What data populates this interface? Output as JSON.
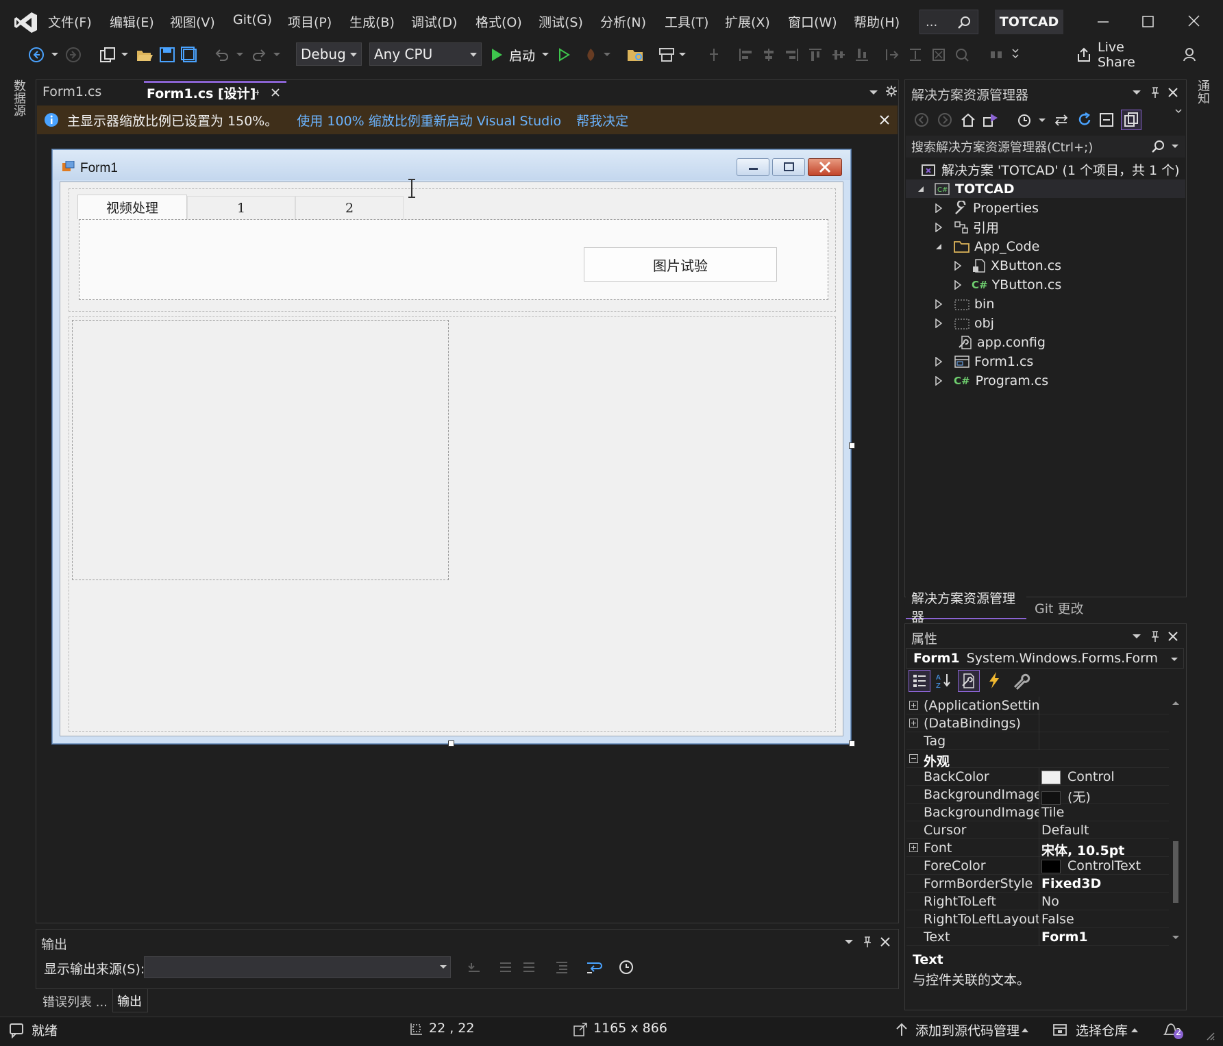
{
  "app": {
    "solution_name": "TOTCAD",
    "search_dots": "..."
  },
  "menu": [
    "文件(F)",
    "编辑(E)",
    "视图(V)",
    "Git(G)",
    "项目(P)",
    "生成(B)",
    "调试(D)",
    "格式(O)",
    "测试(S)",
    "分析(N)",
    "工具(T)",
    "扩展(X)",
    "窗口(W)",
    "帮助(H)"
  ],
  "toolbar": {
    "config": "Debug",
    "platform": "Any CPU",
    "start_label": "启动",
    "live_share": "Live Share"
  },
  "side_left": {
    "label": "数据源"
  },
  "side_right": {
    "label": "通知"
  },
  "tabs": [
    {
      "label": "Form1.cs"
    },
    {
      "label": "Form1.cs [设计]"
    }
  ],
  "infobar": {
    "message": "主显示器缩放比例已设置为 150%。",
    "link1": "使用 100% 缩放比例重新启动 Visual Studio",
    "link2": "帮我决定"
  },
  "form": {
    "title": "Form1",
    "tabs": [
      "视频处理",
      "1",
      "2"
    ],
    "button": "图片试验"
  },
  "solution_explorer": {
    "title": "解决方案资源管理器",
    "search_placeholder": "搜索解决方案资源管理器(Ctrl+;)",
    "items": [
      {
        "label": "解决方案 'TOTCAD' (1 个项目，共 1 个)"
      },
      {
        "label": "TOTCAD"
      },
      {
        "label": "Properties"
      },
      {
        "label": "引用"
      },
      {
        "label": "App_Code"
      },
      {
        "label": "XButton.cs"
      },
      {
        "label": "YButton.cs"
      },
      {
        "label": "bin"
      },
      {
        "label": "obj"
      },
      {
        "label": "app.config"
      },
      {
        "label": "Form1.cs"
      },
      {
        "label": "Program.cs"
      }
    ],
    "tabs": [
      "解决方案资源管理器",
      "Git 更改"
    ]
  },
  "properties": {
    "title": "属性",
    "object_name": "Form1",
    "object_type": "System.Windows.Forms.Form",
    "rows": [
      {
        "name": "(ApplicationSetting",
        "value": ""
      },
      {
        "name": "(DataBindings)",
        "value": ""
      },
      {
        "name": "Tag",
        "value": ""
      },
      {
        "name": "外观",
        "value": ""
      },
      {
        "name": "BackColor",
        "value": "Control"
      },
      {
        "name": "BackgroundImage",
        "value": "(无)"
      },
      {
        "name": "BackgroundImageL",
        "value": "Tile"
      },
      {
        "name": "Cursor",
        "value": "Default"
      },
      {
        "name": "Font",
        "value": "宋体, 10.5pt"
      },
      {
        "name": "ForeColor",
        "value": "ControlText"
      },
      {
        "name": "FormBorderStyle",
        "value": "Fixed3D"
      },
      {
        "name": "RightToLeft",
        "value": "No"
      },
      {
        "name": "RightToLeftLayout",
        "value": "False"
      },
      {
        "name": "Text",
        "value": "Form1"
      }
    ],
    "desc_title": "Text",
    "desc_text": "与控件关联的文本。"
  },
  "output": {
    "title": "输出",
    "source_label": "显示输出来源(S):",
    "tabs": [
      "错误列表 ...",
      "输出"
    ]
  },
  "statusbar": {
    "ready": "就绪",
    "position": "22 , 22",
    "size": "1165 x 866",
    "add_source": "添加到源代码管理",
    "select_repo": "选择仓库",
    "notif_count": "2"
  },
  "colors": {
    "accent": "#8a63d2",
    "info_bar": "#3f2f1a",
    "title_bar": "#1f1f1f",
    "status_bar": "#1b1b1b"
  }
}
